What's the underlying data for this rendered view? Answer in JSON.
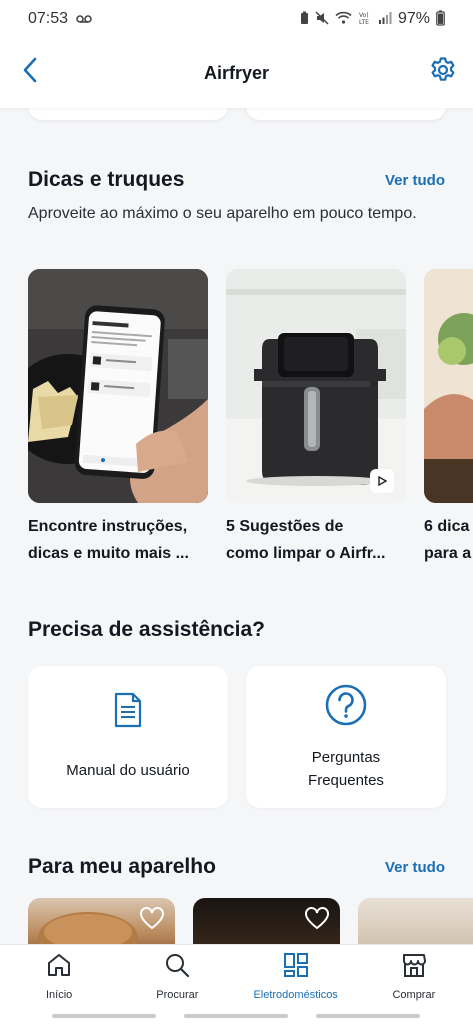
{
  "status_bar": {
    "time": "07:53",
    "battery": "97%"
  },
  "header": {
    "title": "Airfryer"
  },
  "tips": {
    "title": "Dicas e truques",
    "see_all": "Ver tudo",
    "description": "Aproveite ao máximo o seu aparelho em pouco tempo.",
    "cards": [
      {
        "title_line1": "Encontre instruções,",
        "title_line2": "dicas e muito mais ..."
      },
      {
        "title_line1": "5 Sugestões de",
        "title_line2": "como limpar o Airfr..."
      },
      {
        "title_line1": "6 dica",
        "title_line2": "para a"
      }
    ]
  },
  "assistance": {
    "title": "Precisa de assistência?",
    "items": [
      {
        "label": "Manual do usuário",
        "icon": "document-icon"
      },
      {
        "label": "Perguntas Frequentes",
        "icon": "question-circle-icon"
      }
    ]
  },
  "my_device": {
    "title": "Para meu aparelho",
    "see_all": "Ver tudo"
  },
  "bottom_nav": {
    "items": [
      {
        "label": "Início",
        "icon": "home-icon",
        "active": false
      },
      {
        "label": "Procurar",
        "icon": "search-icon",
        "active": false
      },
      {
        "label": "Eletrodomésticos",
        "icon": "appliances-grid-icon",
        "active": true
      },
      {
        "label": "Comprar",
        "icon": "store-icon",
        "active": false
      }
    ]
  },
  "colors": {
    "accent": "#1a6fb5",
    "background": "#f5f6f8",
    "text": "#141820"
  }
}
